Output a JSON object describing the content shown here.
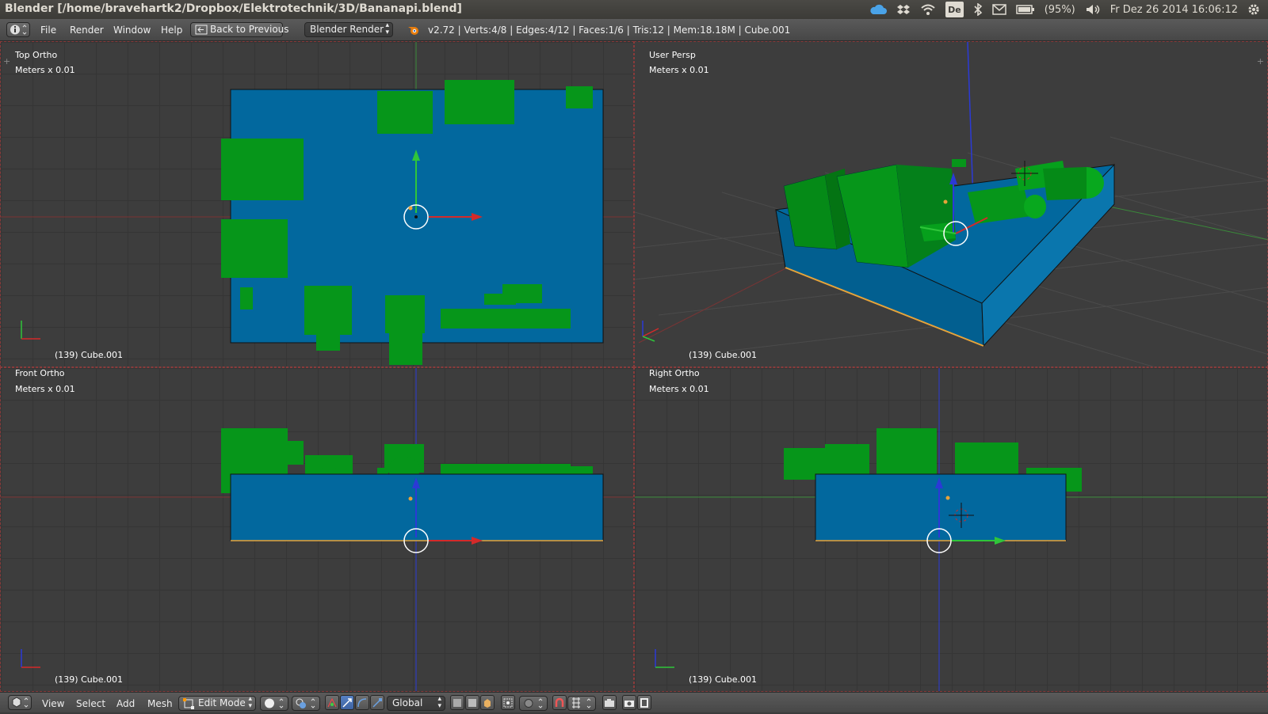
{
  "window": {
    "title": "Blender [/home/bravehartk2/Dropbox/Elektrotechnik/3D/Bananapi.blend]",
    "battery": "(95%)",
    "clock": "Fr Dez 26 2014 16:06:12",
    "keyboard_layout": "De"
  },
  "info_header": {
    "menus": [
      "File",
      "Render",
      "Window",
      "Help"
    ],
    "back_button": "Back to Previous",
    "render_engine": "Blender Render",
    "stats": "v2.72 | Verts:4/8 | Edges:4/12 | Faces:1/6 | Tris:12 | Mem:18.18M | Cube.001"
  },
  "viewports": {
    "top": {
      "view": "Top Ortho",
      "units": "Meters x 0.01",
      "object": "(139) Cube.001"
    },
    "persp": {
      "view": "User Persp",
      "units": "Meters x 0.01",
      "object": "(139) Cube.001"
    },
    "front": {
      "view": "Front Ortho",
      "units": "Meters x 0.01",
      "object": "(139) Cube.001"
    },
    "right": {
      "view": "Right Ortho",
      "units": "Meters x 0.01",
      "object": "(139) Cube.001"
    }
  },
  "view3d_header": {
    "menus": [
      "View",
      "Select",
      "Add",
      "Mesh"
    ],
    "mode": "Edit Mode",
    "orientation": "Global"
  },
  "colors": {
    "board": "#02689e",
    "component": "#06961a",
    "x_axis": "#d42a2a",
    "y_axis": "#2fc53a",
    "z_axis": "#2b3ad6",
    "selected_edge": "#e6a33a"
  }
}
